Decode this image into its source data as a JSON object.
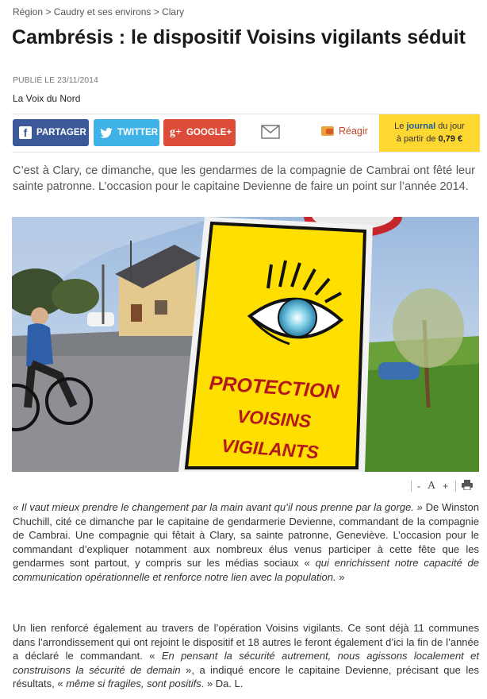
{
  "breadcrumb": "Région > Caudry et ses environs > Clary",
  "article": {
    "title": "Cambrésis : le dispositif Voisins vigilants séduit",
    "published": "PUBLIÉ LE 23/11/2014",
    "source": "La Voix du Nord",
    "intro": "C’est à Clary, ce dimanche, que les gendarmes de la compagnie de Cambrai ont fêté leur sainte patronne. L’occasion pour le capitaine Devienne de faire un point sur l’année 2014."
  },
  "share": {
    "facebook": "PARTAGER",
    "twitter": "TWITTER",
    "google": "GOOGLE+",
    "react": "Réagir",
    "journal": {
      "line1_pre": "Le",
      "line1_word": "journal",
      "line1_post": "du jour",
      "line2_pre": "à partir de",
      "price": "0,79 €"
    }
  },
  "photo": {
    "sign_line1": "PROTECTION",
    "sign_line2": "VOISINS",
    "sign_line3": "VIGILANTS"
  },
  "tools": {
    "minus": "-",
    "font": "A",
    "plus": "+"
  },
  "body": {
    "p1": {
      "a": "« Il vaut mieux prendre le changement par la main avant qu’il nous prenne par la gorge. »",
      "b": " De Winston Chuchill, cité ce dimanche par le capitaine de gendarmerie Devienne, commandant de la compagnie de Cambrai. Une compagnie qui fêtait à Clary, sa sainte patronne, Geneviève. L’occasion pour le commandant d’expliquer notamment aux nombreux élus venus participer à cette fête que les gendarmes sont partout, y compris sur les médias sociaux « ",
      "c": "qui enrichissent notre capacité de communication opérationnelle et renforce notre lien avec la population.",
      "d": " »"
    },
    "p2": {
      "a": "Un lien renforcé également au travers de l’opération Voisins vigilants. Ce sont déjà 11 communes dans l’arrondissement qui ont rejoint le dispositif et 18 autres le feront également d’ici la fin de l’année a déclaré le commandant. « ",
      "b": "En pensant la sécurité autrement, nous agissons localement et construisons la sécurité de demain",
      "c": " », a indiqué encore le capitaine Devienne, précisant que les résultats, « ",
      "d": "même si fragiles, sont positifs",
      "e": ". » Da. L."
    }
  }
}
